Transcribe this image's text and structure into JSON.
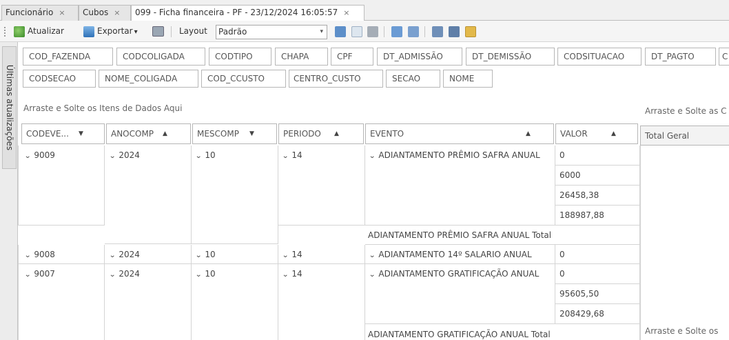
{
  "tabs": [
    {
      "label": "Funcionário",
      "close": "×"
    },
    {
      "label": "Cubos",
      "close": "×"
    },
    {
      "label": "099 - Ficha financeira - PF - 23/12/2024 16:05:57",
      "close": "×"
    }
  ],
  "toolbar": {
    "refresh_label": "Atualizar",
    "export_label": "Exportar",
    "export_arrow": "▾",
    "layout_label": "Layout",
    "layout_value": "Padrão",
    "layout_arrow": "▾"
  },
  "sidebar": {
    "label": "Últimas atualizações"
  },
  "filter_fields": {
    "row1": [
      "COD_FAZENDA",
      "CODCOLIGADA",
      "CODTIPO",
      "CHAPA",
      "CPF",
      "DT_ADMISSÃO",
      "DT_DEMISSÃO",
      "CODSITUACAO",
      "DT_PAGTO",
      "C"
    ],
    "row2": [
      "CODSECAO",
      "NOME_COLIGADA",
      "COD_CCUSTO",
      "CENTRO_CUSTO",
      "SECAO",
      "NOME"
    ]
  },
  "hints": {
    "data_items": "Arraste e Solte os Itens de Dados Aqui",
    "columns": "Arraste e Solte as C",
    "bottom": "Arraste e Solte os"
  },
  "column_headers": [
    {
      "label": "CODEVE...",
      "sort": "▼"
    },
    {
      "label": "ANOCOMP",
      "sort": "▲"
    },
    {
      "label": "MESCOMP",
      "sort": "▼"
    },
    {
      "label": "PERIODO",
      "sort": "▲"
    },
    {
      "label": "EVENTO",
      "sort": "▲"
    },
    {
      "label": "VALOR",
      "sort": "▲"
    }
  ],
  "total_geral": "Total Geral",
  "groups": [
    {
      "codevento": "9009",
      "anocomp": "2024",
      "mescomp": "10",
      "periodo": "14",
      "evento": "ADIANTAMENTO PRÊMIO SAFRA ANUAL",
      "valores": [
        "0",
        "6000",
        "26458,38",
        "188987,88"
      ],
      "total": "ADIANTAMENTO PRÊMIO SAFRA ANUAL Total"
    },
    {
      "codevento": "9008",
      "anocomp": "2024",
      "mescomp": "10",
      "periodo": "14",
      "evento": "ADIANTAMENTO 14º SALARIO ANUAL",
      "valores": [
        "0"
      ],
      "total": ""
    },
    {
      "codevento": "9007",
      "anocomp": "2024",
      "mescomp": "10",
      "periodo": "14",
      "evento": "ADIANTAMENTO GRATIFICAÇÃO ANUAL",
      "valores": [
        "0",
        "95605,50",
        "208429,68"
      ],
      "total": "ADIANTAMENTO GRATIFICAÇÃO ANUAL Total"
    }
  ],
  "chevron": "⌄"
}
